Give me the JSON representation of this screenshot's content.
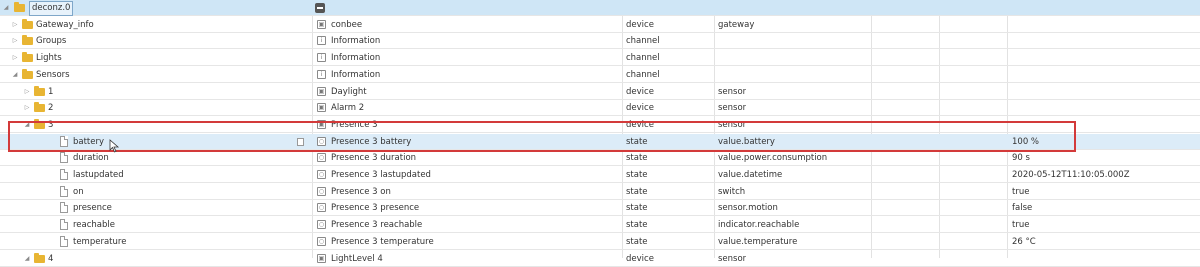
{
  "root": {
    "label": "deconz.0"
  },
  "rows": [
    {
      "label": "Gateway_info",
      "kind": "folder",
      "level": 1,
      "expanded": false,
      "name": "conbee",
      "name_icon": "device-icon",
      "type": "device",
      "role": "gateway",
      "value": ""
    },
    {
      "label": "Groups",
      "kind": "folder",
      "level": 1,
      "expanded": false,
      "name": "Information",
      "name_icon": "channel-icon",
      "type": "channel",
      "role": "",
      "value": ""
    },
    {
      "label": "Lights",
      "kind": "folder",
      "level": 1,
      "expanded": false,
      "name": "Information",
      "name_icon": "channel-icon",
      "type": "channel",
      "role": "",
      "value": ""
    },
    {
      "label": "Sensors",
      "kind": "folder",
      "level": 1,
      "expanded": true,
      "name": "Information",
      "name_icon": "channel-icon",
      "type": "channel",
      "role": "",
      "value": ""
    },
    {
      "label": "1",
      "kind": "folder",
      "level": 2,
      "expanded": false,
      "name": "Daylight",
      "name_icon": "device-icon",
      "type": "device",
      "role": "sensor",
      "value": ""
    },
    {
      "label": "2",
      "kind": "folder",
      "level": 2,
      "expanded": false,
      "name": "Alarm 2",
      "name_icon": "device-icon",
      "type": "device",
      "role": "sensor",
      "value": ""
    },
    {
      "label": "3",
      "kind": "folder",
      "level": 2,
      "expanded": true,
      "name": "Presence 3",
      "name_icon": "device-icon",
      "type": "device",
      "role": "sensor",
      "value": ""
    },
    {
      "label": "battery",
      "kind": "state",
      "level": 3,
      "selected": true,
      "name": "Presence 3 battery",
      "name_icon": "state-icon",
      "type": "state",
      "role": "value.battery",
      "value": "100 %"
    },
    {
      "label": "duration",
      "kind": "state",
      "level": 3,
      "name": "Presence 3 duration",
      "name_icon": "state-icon",
      "type": "state",
      "role": "value.power.consumption",
      "value": "90 s"
    },
    {
      "label": "lastupdated",
      "kind": "state",
      "level": 3,
      "name": "Presence 3 lastupdated",
      "name_icon": "state-icon",
      "type": "state",
      "role": "value.datetime",
      "value": "2020-05-12T11:10:05.000Z"
    },
    {
      "label": "on",
      "kind": "state",
      "level": 3,
      "name": "Presence 3 on",
      "name_icon": "state-icon",
      "type": "state",
      "role": "switch",
      "value": "true"
    },
    {
      "label": "presence",
      "kind": "state",
      "level": 3,
      "name": "Presence 3 presence",
      "name_icon": "state-icon",
      "type": "state",
      "role": "sensor.motion",
      "value": "false"
    },
    {
      "label": "reachable",
      "kind": "state",
      "level": 3,
      "name": "Presence 3 reachable",
      "name_icon": "state-icon",
      "type": "state",
      "role": "indicator.reachable",
      "value": "true"
    },
    {
      "label": "temperature",
      "kind": "state",
      "level": 3,
      "name": "Presence 3 temperature",
      "name_icon": "state-icon",
      "type": "state",
      "role": "value.temperature",
      "value": "26 °C"
    },
    {
      "label": "4",
      "kind": "folder",
      "level": 2,
      "expanded": true,
      "name": "LightLevel 4",
      "name_icon": "device-icon",
      "type": "device",
      "role": "sensor",
      "value": ""
    }
  ],
  "colors": {
    "selection": "#dcecf8",
    "root_bg": "#cfe6f6",
    "folder": "#e8b533",
    "highlight": "#d33a3a"
  }
}
